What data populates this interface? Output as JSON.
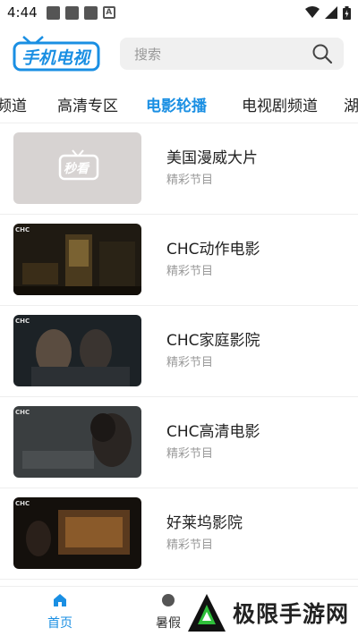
{
  "status_bar": {
    "time": "4:44",
    "left_icons": [
      "notification-square-icon",
      "notification-square-icon",
      "notification-square-icon",
      "a-notification-icon"
    ],
    "right_icons": [
      "wifi-icon",
      "signal-icon",
      "battery-icon"
    ]
  },
  "header": {
    "logo_text": "手机电视",
    "search": {
      "placeholder": "搜索"
    }
  },
  "tabs": [
    {
      "label": "频道"
    },
    {
      "label": "高清专区"
    },
    {
      "label": "电影轮播",
      "active": true
    },
    {
      "label": "电视剧频道"
    },
    {
      "label": "湖"
    }
  ],
  "items": [
    {
      "title": "美国漫威大片",
      "subtitle": "精彩节目",
      "thumb_text": "秒看"
    },
    {
      "title": "CHC动作电影",
      "subtitle": "精彩节目",
      "thumb_text": "CHC"
    },
    {
      "title": "CHC家庭影院",
      "subtitle": "精彩节目",
      "thumb_text": "CHC"
    },
    {
      "title": "CHC高清电影",
      "subtitle": "精彩节目",
      "thumb_text": "CHC"
    },
    {
      "title": "好莱坞影院",
      "subtitle": "精彩节目",
      "thumb_text": "CHC"
    }
  ],
  "bottom_nav": [
    {
      "label": "首页",
      "icon": "home-icon",
      "active": true
    },
    {
      "label": "暑假",
      "icon": "holiday-icon"
    }
  ],
  "watermark": {
    "text": "极限手游网"
  },
  "colors": {
    "accent": "#1a8fe3",
    "placeholder_thumb": "#d7d3d2"
  }
}
